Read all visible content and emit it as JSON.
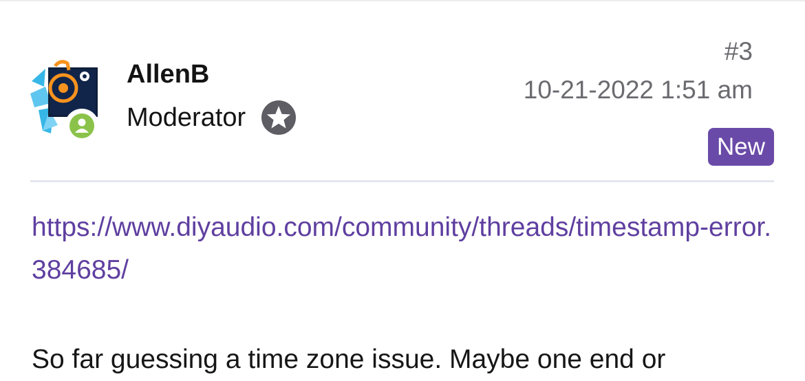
{
  "post": {
    "author": {
      "name": "AllenB",
      "role": "Moderator",
      "avatar_icon": "speaker-logo-avatar-icon",
      "badge_icon": "user-icon",
      "rank_icon": "star-icon"
    },
    "number": "#3",
    "date": "10-21-2022 1:51 am",
    "new_label": "New",
    "link": "https://www.diyaudio.com/community/threads/timestamp-error.384685/",
    "body_line": "So far guessing a time zone issue. Maybe one end or"
  },
  "colors": {
    "accent": "#6a4aa8",
    "link": "#5f3fa0",
    "meta_text": "#6a6a6f",
    "divider": "#e3e6ec",
    "badge_green": "#8bc34a"
  }
}
